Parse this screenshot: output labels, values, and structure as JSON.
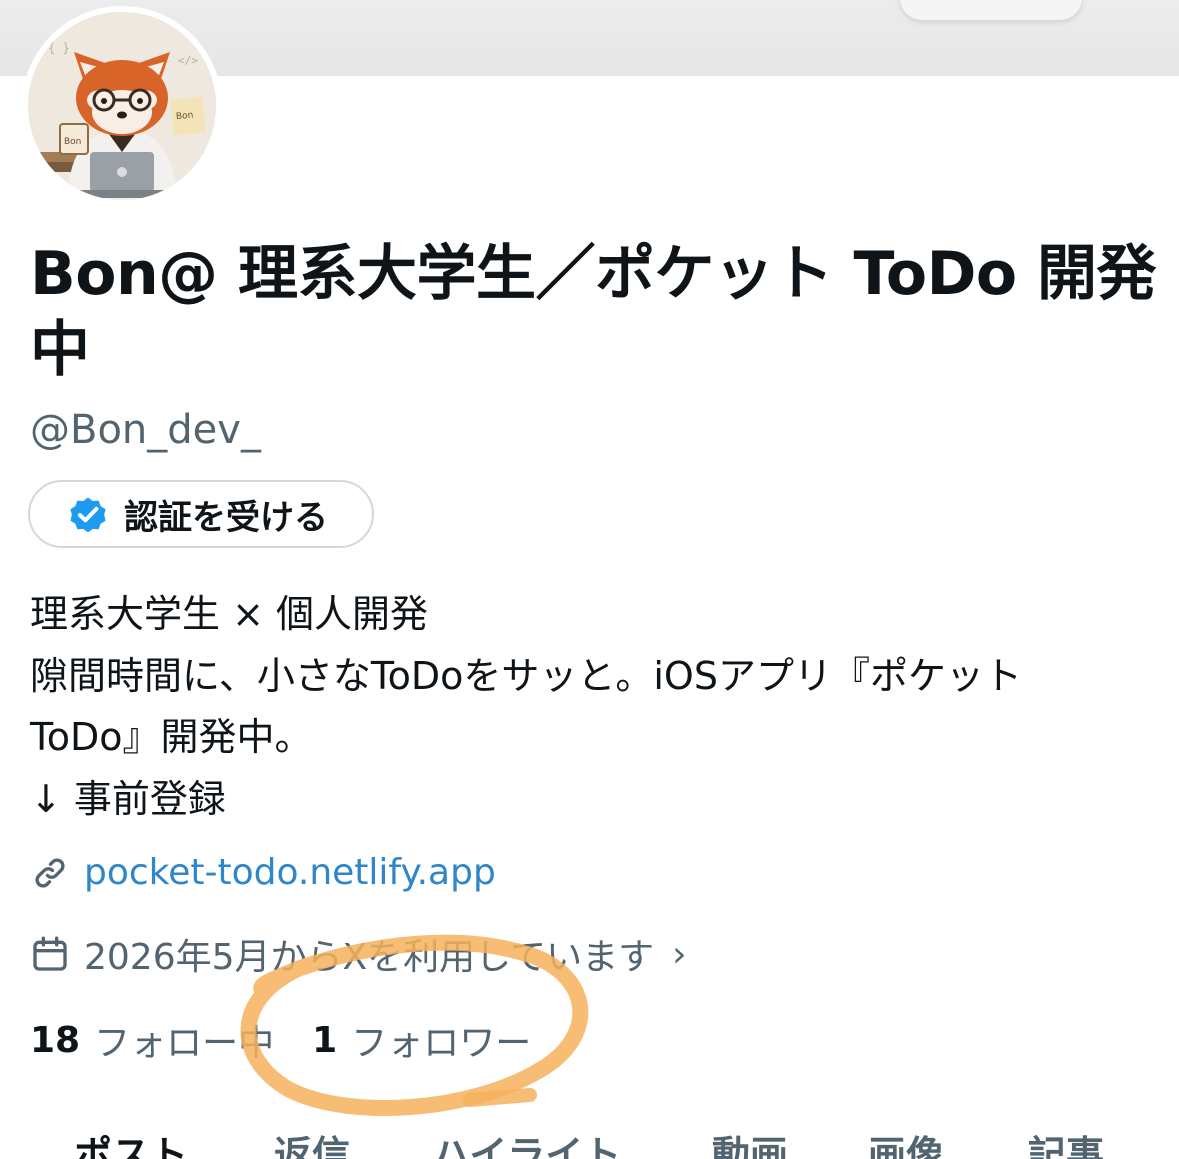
{
  "profile": {
    "display_name": "Bon@ 理系大学生／ポケット ToDo 開発中",
    "handle": "@Bon_dev_",
    "verify_button_label": "認証を受ける",
    "bio_lines": [
      "理系大学生 × 個人開発",
      "隙間時間に、小さなToDoをサッと。iOSアプリ『ポケット",
      "ToDo』開発中。",
      "↓ 事前登録"
    ],
    "link": "pocket-todo.netlify.app",
    "joined": "2026年5月からXを利用しています",
    "joined_chevron": "›",
    "following_count": "18",
    "following_label": "フォロー中",
    "followers_count": "1",
    "followers_label": "フォロワー"
  },
  "tabs": [
    {
      "label": "ポスト",
      "active": true
    },
    {
      "label": "返信",
      "active": false
    },
    {
      "label": "ハイライト",
      "active": false
    },
    {
      "label": "動画",
      "active": false
    },
    {
      "label": "画像",
      "active": false
    },
    {
      "label": "記事",
      "active": false
    }
  ],
  "avatar": {
    "mug_text": "Bon",
    "note_text": "Bon"
  },
  "icons": {
    "verify": "verified-badge-icon",
    "link": "link-icon",
    "joined": "calendar-icon"
  },
  "colors": {
    "text_primary": "#0f1419",
    "text_secondary": "#536471",
    "link": "#2f86c8",
    "verified_blue": "#1d9bf0",
    "annotation_circle": "#f6b25c"
  }
}
